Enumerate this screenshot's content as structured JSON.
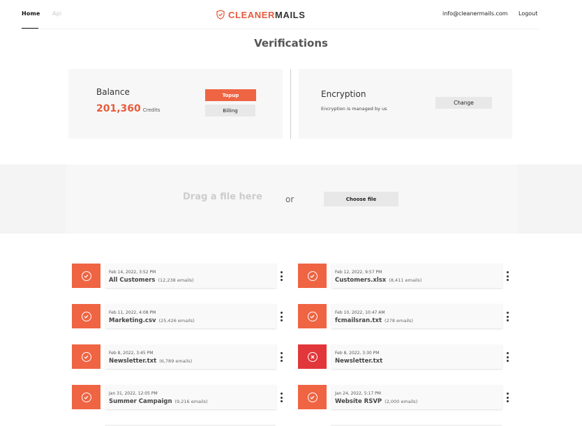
{
  "nav": {
    "home": "Home",
    "api": "Api",
    "email": "info@cleanermails.com",
    "logout": "Logout"
  },
  "logo": {
    "part1": "CLEANER",
    "part2": "MAILS",
    "icon": "shield-check-icon",
    "color": "#e85a3c"
  },
  "page": {
    "title": "Verifications"
  },
  "balance": {
    "title": "Balance",
    "value": "201,360",
    "unit": "Credits",
    "topup_label": "Topup",
    "billing_label": "Billing"
  },
  "encryption": {
    "title": "Encryption",
    "description": "Encryption is managed by us",
    "change_label": "Change"
  },
  "upload": {
    "drag_text": "Drag a file here",
    "or_text": "or",
    "choose_label": "Choose file"
  },
  "colors": {
    "accent": "#ef6443",
    "error": "#e2373a"
  },
  "files": [
    {
      "date": "Feb 14, 2022, 3:52 PM",
      "name": "All Customers",
      "count": "(12,238 emails)",
      "status": "success"
    },
    {
      "date": "Feb 12, 2022, 9:57 PM",
      "name": "Customers.xlsx",
      "count": "(8,411 emails)",
      "status": "success"
    },
    {
      "date": "Feb 11, 2022, 4:08 PM",
      "name": "Marketing.csv",
      "count": "(25,426 emails)",
      "status": "success"
    },
    {
      "date": "Feb 10, 2022, 10:47 AM",
      "name": "fcmailsran.txt",
      "count": "(278 emails)",
      "status": "success"
    },
    {
      "date": "Feb 8, 2022, 3:45 PM",
      "name": "Newsletter.txt",
      "count": "(6,789 emails)",
      "status": "success"
    },
    {
      "date": "Feb 8, 2022, 3:30 PM",
      "name": "Newsletter.txt",
      "count": "",
      "status": "error"
    },
    {
      "date": "Jan 31, 2022, 12:05 PM",
      "name": "Summer Campaign",
      "count": "(9,216 emails)",
      "status": "success"
    },
    {
      "date": "Jan 24, 2022, 5:17 PM",
      "name": "Website RSVP",
      "count": "(2,000 emails)",
      "status": "success"
    }
  ]
}
